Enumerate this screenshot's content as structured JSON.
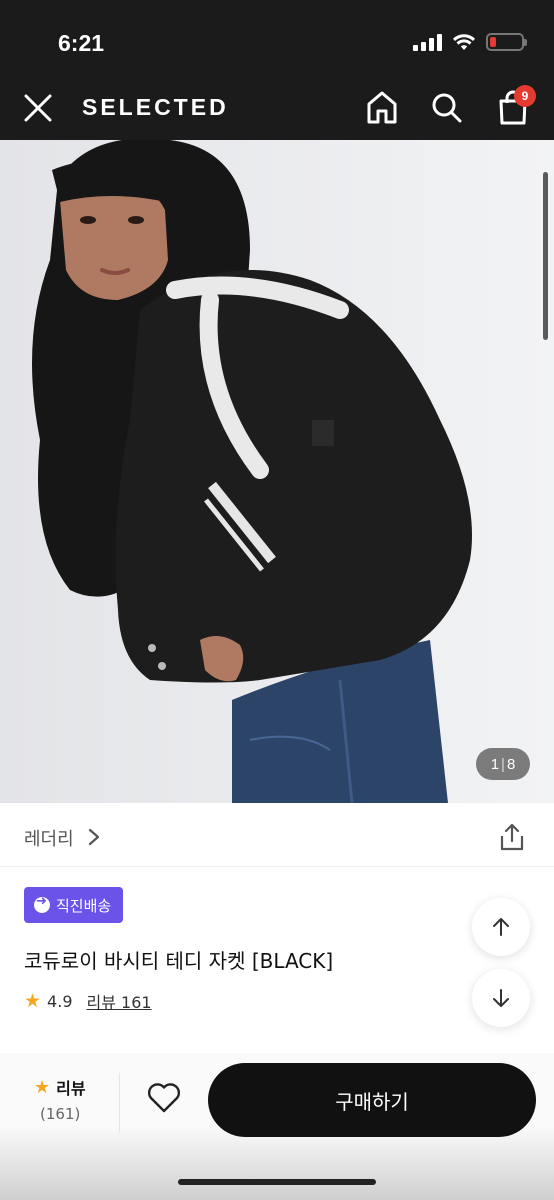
{
  "status": {
    "time": "6:21",
    "icons": [
      "signal-icon",
      "wifi-icon",
      "battery-low-icon"
    ]
  },
  "header": {
    "brand": "SELECTED",
    "cart_count": "9",
    "icons": [
      "close-icon",
      "home-icon",
      "search-icon",
      "shopping-bag-icon"
    ]
  },
  "gallery": {
    "current": "1",
    "separator": "|",
    "total": "8"
  },
  "product": {
    "shop_name": "레더리",
    "badge": "직진배송",
    "title": "코듀로이 바시티 테디 자켓 [BLACK]",
    "rating": "4.9",
    "review_link": "리뷰 161"
  },
  "bottom_bar": {
    "review_label": "리뷰",
    "review_count": "(161)",
    "buy_label": "구매하기"
  },
  "colors": {
    "accent": "#6b52e8",
    "badge_red": "#e53a2e",
    "star": "#f5a623",
    "header_bg": "#1b1b1b"
  }
}
